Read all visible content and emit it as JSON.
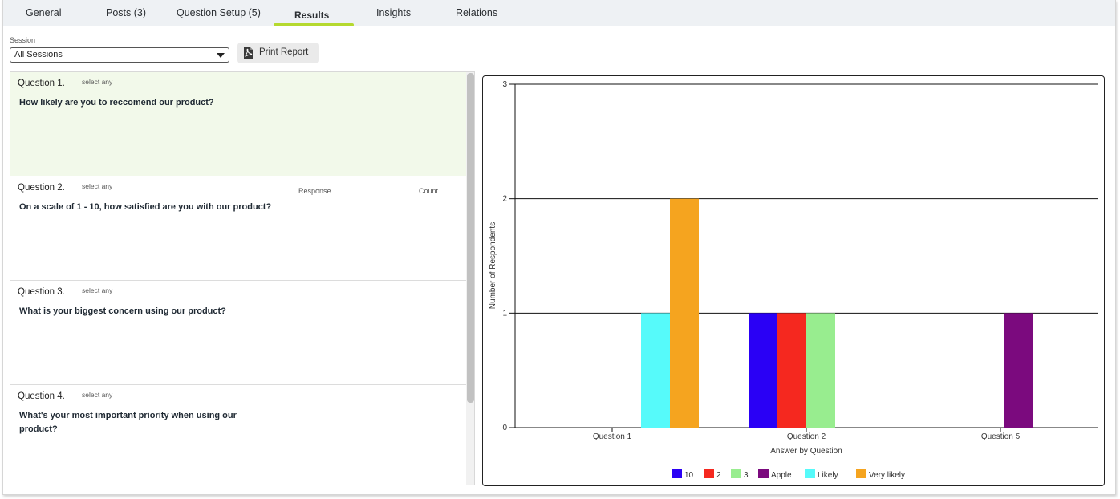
{
  "tabs": [
    {
      "label": "General"
    },
    {
      "label": "Posts (3)"
    },
    {
      "label": "Question Setup (5)"
    },
    {
      "label": "Results"
    },
    {
      "label": "Insights"
    },
    {
      "label": "Relations"
    }
  ],
  "active_tab": "Results",
  "session": {
    "label": "Session",
    "value": "All Sessions"
  },
  "print_button": {
    "label": "Print Report",
    "icon": "pdf-icon"
  },
  "questions": [
    {
      "number": "Question 1.",
      "type": "select any",
      "text": "How likely are you to reccomend our product?",
      "selected": true
    },
    {
      "number": "Question 2.",
      "type": "select any",
      "text": "On a scale of 1 - 10, how satisfied are you with our product?",
      "col_response": "Response",
      "col_count": "Count"
    },
    {
      "number": "Question 3.",
      "type": "select any",
      "text": "What is your biggest concern using our product?"
    },
    {
      "number": "Question 4.",
      "type": "select any",
      "text": "What's your most important priority when using our product?"
    }
  ],
  "colors": {
    "accent": "#b5d92f",
    "selected_bg": "#f2f9ea"
  },
  "chart_data": {
    "type": "bar",
    "categories": [
      "Question 1",
      "Question 2",
      "Question 5"
    ],
    "series": [
      {
        "name": "10",
        "color": "#2a00f5",
        "values": [
          0,
          1,
          0
        ]
      },
      {
        "name": "2",
        "color": "#f5281f",
        "values": [
          0,
          1,
          0
        ]
      },
      {
        "name": "3",
        "color": "#98ed8f",
        "values": [
          0,
          1,
          0
        ]
      },
      {
        "name": "Apple",
        "color": "#7b0a7e",
        "values": [
          0,
          0,
          1
        ]
      },
      {
        "name": "Likely",
        "color": "#56fafa",
        "values": [
          1,
          0,
          0
        ]
      },
      {
        "name": "Very likely",
        "color": "#f5a41f",
        "values": [
          2,
          0,
          0
        ]
      }
    ],
    "xlabel": "Answer by Question",
    "ylabel": "Number of Respondents",
    "ylim": [
      0,
      3
    ],
    "yticks": [
      0,
      1,
      2,
      3
    ],
    "grid": true,
    "legend": "bottom"
  }
}
